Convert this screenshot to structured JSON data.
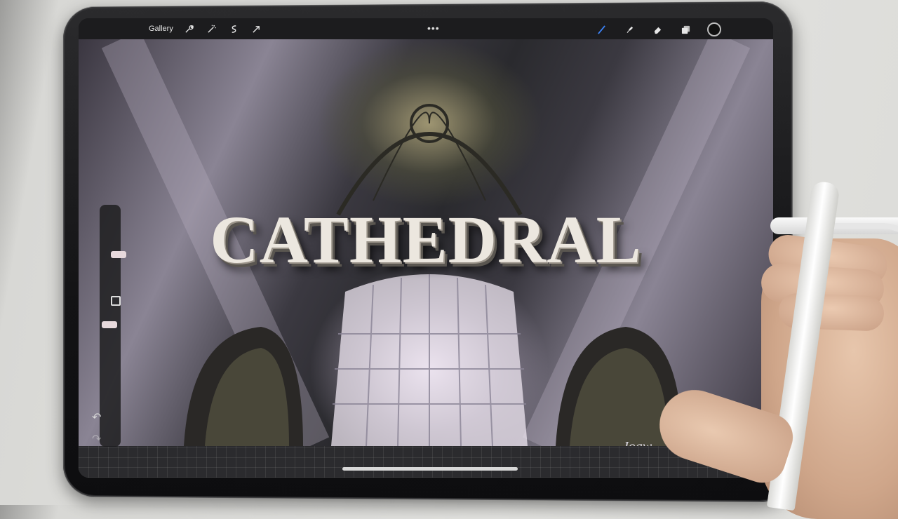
{
  "toolbar": {
    "gallery_label": "Gallery",
    "left_icons": [
      "wrench-icon",
      "magic-wand-icon",
      "selection-icon",
      "transform-arrow-icon"
    ],
    "more_menu": "•••",
    "right_icons": [
      "brush-icon",
      "smudge-icon",
      "eraser-icon",
      "layers-icon",
      "color-well-icon"
    ]
  },
  "canvas": {
    "title_text": "CATHEDRAL",
    "signature": "Joaw"
  },
  "sidebar": {
    "brush_size_level": 0.2,
    "opacity_level": 0.55,
    "undo_symbol": "↶",
    "redo_symbol": "↷"
  },
  "colors": {
    "toolbar_bg": "#1c1c1e",
    "brush_active": "#3b82f6",
    "text_fill": "#ece7df"
  }
}
